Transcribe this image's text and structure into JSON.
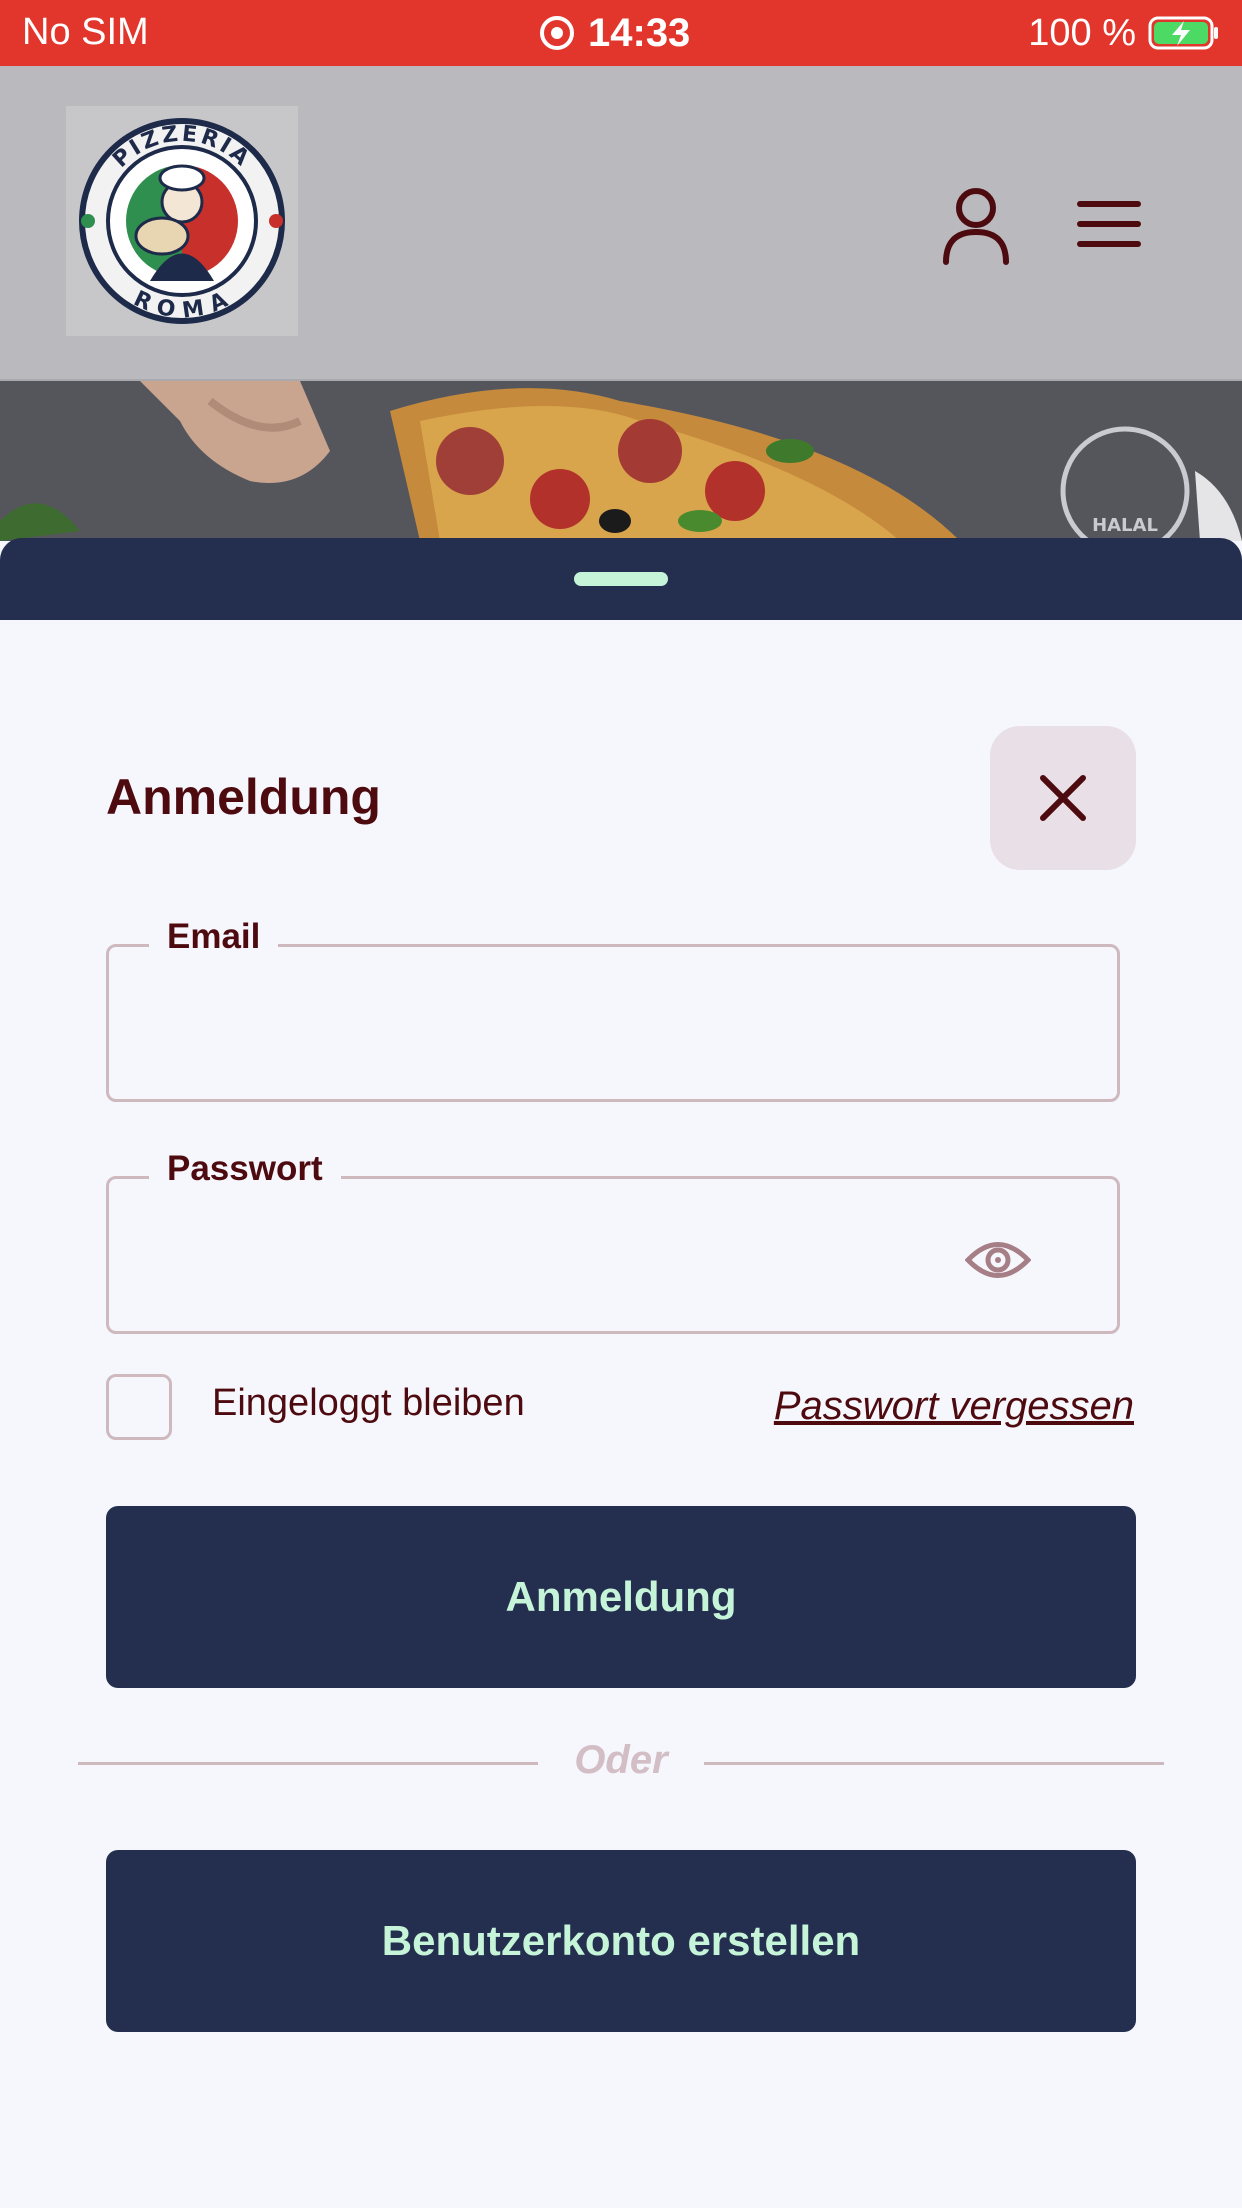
{
  "status_bar": {
    "carrier": "No SIM",
    "time": "14:33",
    "battery_percent": "100 %",
    "bg_color": "#e2362c"
  },
  "header": {
    "logo": {
      "icon": "pizzeria-roma-logo",
      "brand_line1": "PIZZERIA",
      "brand_line2": "ROMA"
    },
    "user_icon": "user-icon",
    "menu_icon": "hamburger-menu-icon"
  },
  "hero": {
    "badge_text": "HALAL"
  },
  "login_sheet": {
    "title": "Anmeldung",
    "close_icon": "close-icon",
    "email": {
      "label": "Email",
      "value": ""
    },
    "password": {
      "label": "Passwort",
      "value": "",
      "toggle_icon": "eye-icon"
    },
    "remember_me": {
      "label": "Eingeloggt bleiben",
      "checked": false
    },
    "forgot_password_link": "Passwort vergessen",
    "login_button": "Anmeldung",
    "divider_text": "Oder",
    "register_button": "Benutzerkonto erstellen"
  },
  "colors": {
    "primary_navy": "#242e4e",
    "accent_mint": "#c5f4d9",
    "text_maroon": "#4d0b10",
    "sheet_bg": "#f6f6fd",
    "border": "#cdb9be"
  }
}
